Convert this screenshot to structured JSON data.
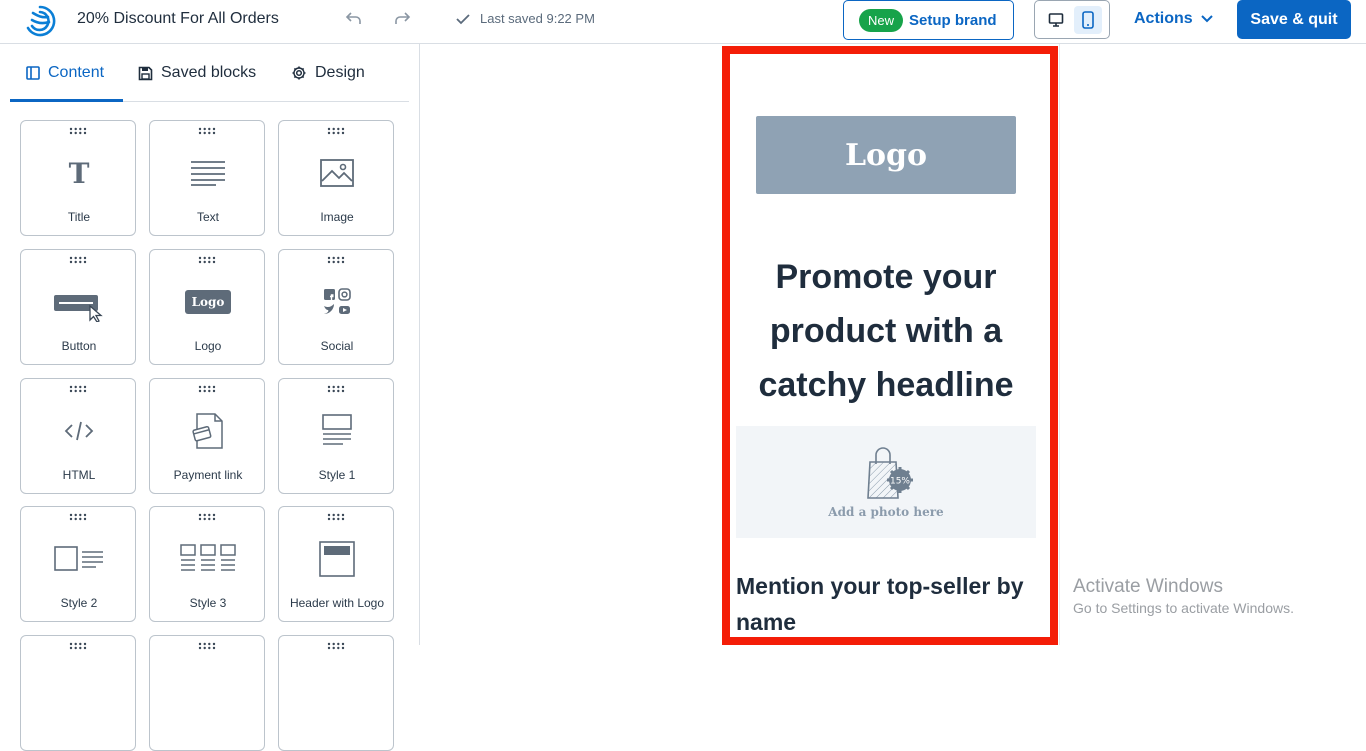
{
  "header": {
    "title": "20% Discount For All Orders",
    "last_saved": "Last saved 9:22 PM",
    "setup_brand": {
      "badge": "New",
      "label": "Setup brand"
    },
    "actions_label": "Actions",
    "save_quit_label": "Save & quit",
    "device_selected": "mobile"
  },
  "sidebar": {
    "tabs": [
      {
        "label": "Content",
        "icon": "layout-icon",
        "active": true
      },
      {
        "label": "Saved blocks",
        "icon": "save-icon",
        "active": false
      },
      {
        "label": "Design",
        "icon": "gear-icon",
        "active": false
      }
    ],
    "blocks": [
      {
        "label": "Title",
        "icon": "title-icon"
      },
      {
        "label": "Text",
        "icon": "text-icon"
      },
      {
        "label": "Image",
        "icon": "image-icon"
      },
      {
        "label": "Button",
        "icon": "button-icon"
      },
      {
        "label": "Logo",
        "icon": "logo-icon",
        "icon_text": "Logo"
      },
      {
        "label": "Social",
        "icon": "social-icon"
      },
      {
        "label": "HTML",
        "icon": "html-icon"
      },
      {
        "label": "Payment link",
        "icon": "payment-link-icon"
      },
      {
        "label": "Style 1",
        "icon": "style1-icon"
      },
      {
        "label": "Style 2",
        "icon": "style2-icon"
      },
      {
        "label": "Style 3",
        "icon": "style3-icon"
      },
      {
        "label": "Header with Logo",
        "icon": "header-logo-icon"
      }
    ]
  },
  "email": {
    "logo_text": "Logo",
    "headline": "Promote your product with a catchy headline",
    "photo": {
      "label": "Add a photo here",
      "badge": "15%"
    },
    "subheading": "Mention your top-seller by name"
  },
  "watermark": {
    "line1": "Activate Windows",
    "line2": "Go to Settings to activate Windows."
  },
  "colors": {
    "accent": "#0b66c3",
    "new_badge": "#17a34a",
    "selection_border": "#f41d07",
    "logo_placeholder": "#8fa2b4"
  }
}
